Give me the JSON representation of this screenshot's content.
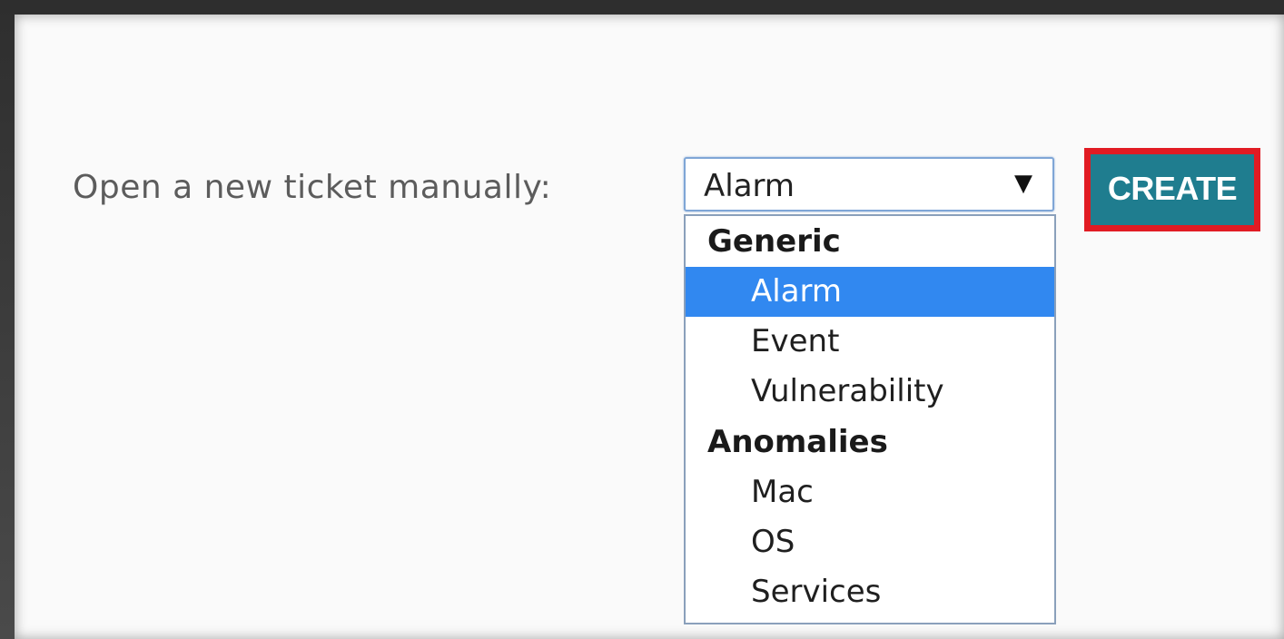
{
  "form": {
    "label": "Open a new ticket manually:",
    "select": {
      "value": "Alarm",
      "arrow_icon": "▼"
    },
    "dropdown": {
      "groups": [
        {
          "label": "Generic",
          "options": [
            "Alarm",
            "Event",
            "Vulnerability"
          ]
        },
        {
          "label": "Anomalies",
          "options": [
            "Mac",
            "OS",
            "Services"
          ]
        }
      ],
      "selected_option": "Alarm"
    },
    "create_button": {
      "label": "CREATE",
      "highlight_color": "#e11b23",
      "background_color": "#1f7d8f"
    }
  },
  "colors": {
    "selected_option_bg": "#3188f0",
    "select_border": "#7fa6d6"
  }
}
